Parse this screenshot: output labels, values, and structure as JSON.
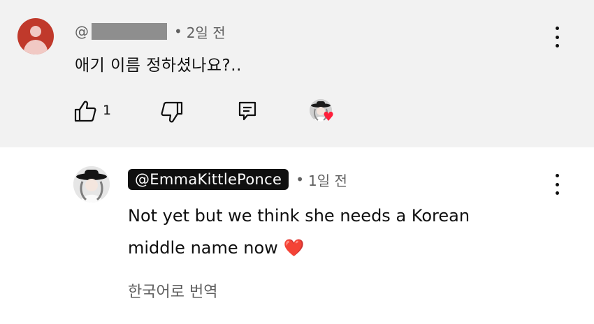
{
  "comment": {
    "at_prefix": "@",
    "dot": "•",
    "time": "2일 전",
    "text": "애기  이름  정하셨나요?..",
    "likes": "1"
  },
  "reply": {
    "handle": "@EmmaKittlePonce",
    "dot": "•",
    "time": "1일 전",
    "line1": "Not yet but we think she needs a Korean",
    "line2_text": "middle name now",
    "heart": "❤️",
    "translate": "한국어로 번역"
  },
  "icons": {
    "like": "thumb-up-outline-icon",
    "dislike": "thumb-down-outline-icon",
    "reply": "comment-reply-icon",
    "more": "more-vertical-icon",
    "creator_heart": "creator-heart-badge"
  },
  "colors": {
    "top_bg": "#f2f2f2",
    "avatar_red": "#c0392b",
    "heart_red": "#ff1f3a",
    "muted_text": "#606060"
  }
}
